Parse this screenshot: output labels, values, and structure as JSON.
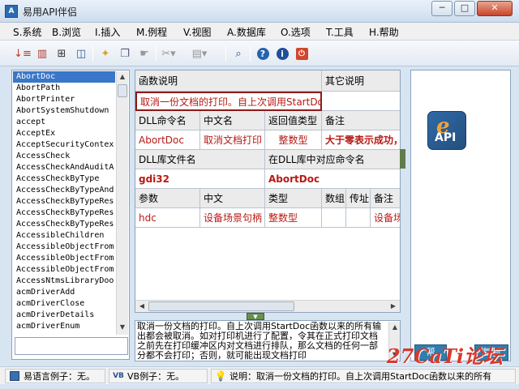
{
  "window": {
    "title": "易用API伴侣",
    "app_icon": "app-icon"
  },
  "menu": [
    {
      "label": "S.系统"
    },
    {
      "label": "B.浏览"
    },
    {
      "label": "I.插入"
    },
    {
      "label": "M.例程"
    },
    {
      "label": "V.视图"
    },
    {
      "label": "A.数据库"
    },
    {
      "label": "O.选项"
    },
    {
      "label": "T.工具"
    },
    {
      "label": "H.帮助"
    }
  ],
  "toolbar_icons": [
    "sort-icon",
    "book-icon",
    "tree-icon",
    "database-icon",
    "star-icon",
    "copy-icon",
    "pointer-icon",
    "tools-icon",
    "layout-icon",
    "search-icon",
    "help-icon",
    "info-icon",
    "exit-icon"
  ],
  "api_list": {
    "items": [
      "AbortDoc",
      "AbortPath",
      "AbortPrinter",
      "AbortSystemShutdown",
      "accept",
      "AcceptEx",
      "AcceptSecurityContex",
      "AccessCheck",
      "AccessCheckAndAuditA",
      "AccessCheckByType",
      "AccessCheckByTypeAnd",
      "AccessCheckByTypeRes",
      "AccessCheckByTypeRes",
      "AccessCheckByTypeRes",
      "AccessibleChildren",
      "AccessibleObjectFrom",
      "AccessibleObjectFrom",
      "AccessibleObjectFrom",
      "AccessNtmsLibraryDoo",
      "acmDriverAdd",
      "acmDriverClose",
      "acmDriverDetails",
      "acmDriverEnum"
    ],
    "selected": "AbortDoc"
  },
  "detail": {
    "func_desc_label": "函数说明",
    "other_desc_label": "其它说明",
    "func_desc_value": "取消一份文档的打印。自上次调用StartDoc",
    "dll_cmd_label": "DLL命令名",
    "cn_name_label": "中文名",
    "return_type_label": "返回值类型",
    "note_label": "备注",
    "dll_cmd_value": "AbortDoc",
    "cn_name_value": "取消文档打印",
    "return_type_value": "整数型",
    "note_value": "大于零表示成功，",
    "dll_file_label": "DLL库文件名",
    "dll_cmd_in_lib_label": "在DLL库中对应命令名",
    "dll_file_value": "gdi32",
    "dll_cmd_in_lib_value": "AbortDoc",
    "param_headers": [
      "参数",
      "中文",
      "类型",
      "数组",
      "传址",
      "备注"
    ],
    "param_row": [
      "hdc",
      "设备场景句柄",
      "整数型",
      "",
      "",
      "设备场"
    ]
  },
  "description": "取消一份文档的打印。自上次调用StartDoc函数以来的所有输出都会被取消。如对打印机进行了配置，令其在正式打印文档之前先在打印缓冲区内对文档进行排队，那么文档的任何一部分都不会打印；否则，就可能出现文档打印",
  "right_panel": {
    "logo_letter": "e",
    "logo_text": "API",
    "btn_left": "帮",
    "btn_right": "复制"
  },
  "watermark": "27CaTi论坛",
  "status": {
    "yiyu_label": "易语言例子：无。",
    "vb_label": "VB例子：无。",
    "info_label": "说明：取消一份文档的打印。自上次调用StartDoc函数以来的所有"
  }
}
